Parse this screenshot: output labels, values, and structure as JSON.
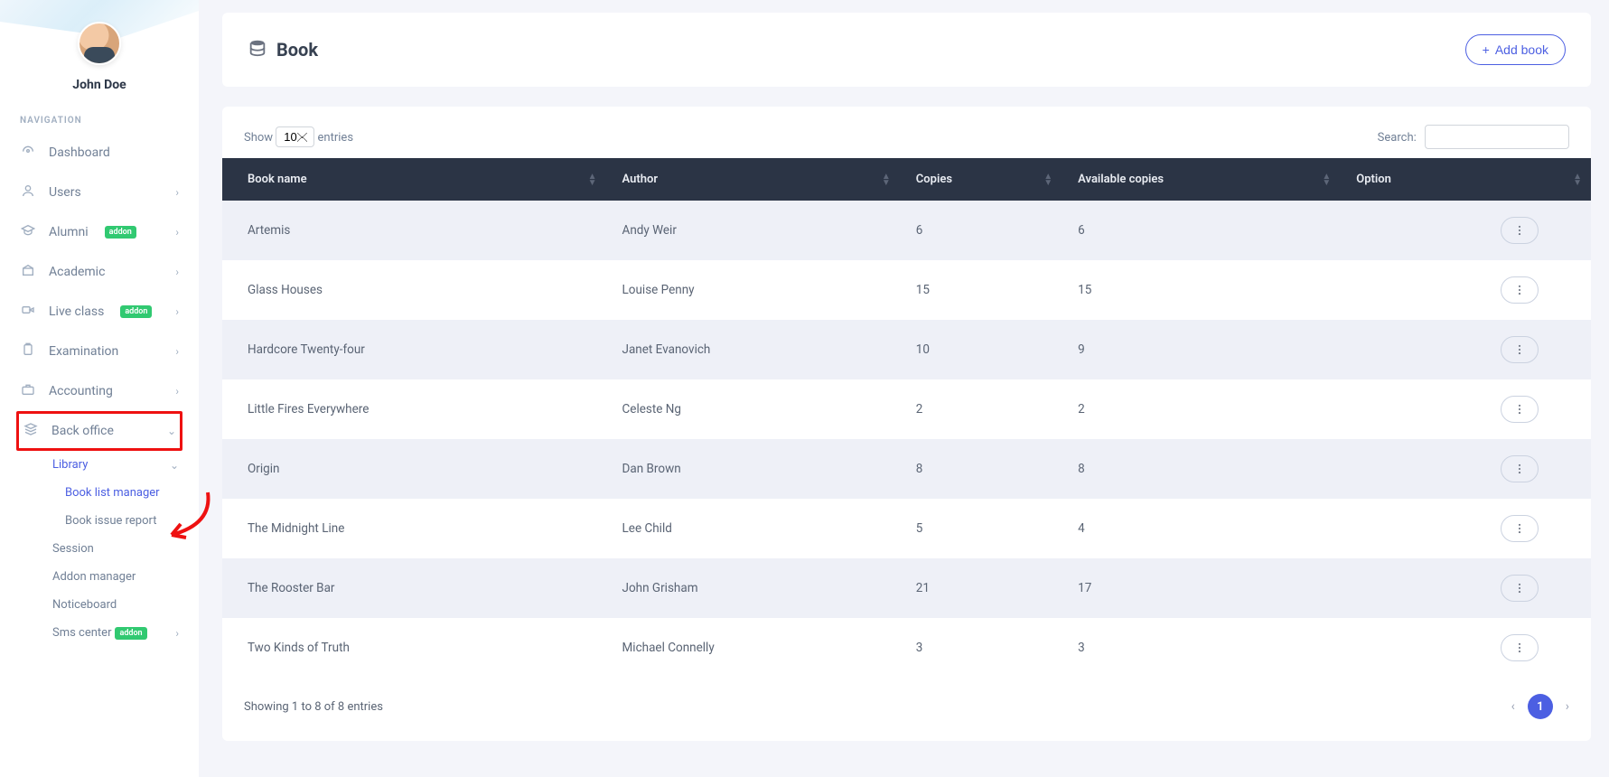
{
  "user": {
    "name": "John Doe"
  },
  "sidebar": {
    "section_label": "NAVIGATION",
    "items": {
      "dashboard": {
        "label": "Dashboard"
      },
      "users": {
        "label": "Users"
      },
      "alumni": {
        "label": "Alumni",
        "badge": "addon"
      },
      "academic": {
        "label": "Academic"
      },
      "liveclass": {
        "label": "Live class",
        "badge": "addon"
      },
      "examination": {
        "label": "Examination"
      },
      "accounting": {
        "label": "Accounting"
      },
      "backoffice": {
        "label": "Back office"
      }
    },
    "backoffice_children": {
      "library": {
        "label": "Library"
      },
      "session": {
        "label": "Session"
      },
      "addon_manager": {
        "label": "Addon manager"
      },
      "noticeboard": {
        "label": "Noticeboard"
      },
      "sms_center": {
        "label": "Sms center",
        "badge": "addon"
      }
    },
    "library_children": {
      "book_list": {
        "label": "Book list manager"
      },
      "issue_report": {
        "label": "Book issue report"
      }
    }
  },
  "page": {
    "title": "Book",
    "add_button": "Add book"
  },
  "table": {
    "show_prefix": "Show",
    "show_suffix": "entries",
    "length_value": "10",
    "search_label": "Search:",
    "columns": {
      "name": "Book name",
      "author": "Author",
      "copies": "Copies",
      "available": "Available copies",
      "option": "Option"
    },
    "rows": [
      {
        "name": "Artemis",
        "author": "Andy Weir",
        "copies": "6",
        "available": "6"
      },
      {
        "name": "Glass Houses",
        "author": "Louise Penny",
        "copies": "15",
        "available": "15"
      },
      {
        "name": "Hardcore Twenty-four",
        "author": "Janet Evanovich",
        "copies": "10",
        "available": "9"
      },
      {
        "name": "Little Fires Everywhere",
        "author": "Celeste Ng",
        "copies": "2",
        "available": "2"
      },
      {
        "name": "Origin",
        "author": "Dan Brown",
        "copies": "8",
        "available": "8"
      },
      {
        "name": "The Midnight Line",
        "author": "Lee Child",
        "copies": "5",
        "available": "4"
      },
      {
        "name": "The Rooster Bar",
        "author": "John Grisham",
        "copies": "21",
        "available": "17"
      },
      {
        "name": "Two Kinds of Truth",
        "author": "Michael Connelly",
        "copies": "3",
        "available": "3"
      }
    ],
    "info": "Showing 1 to 8 of 8 entries",
    "page_current": "1"
  }
}
